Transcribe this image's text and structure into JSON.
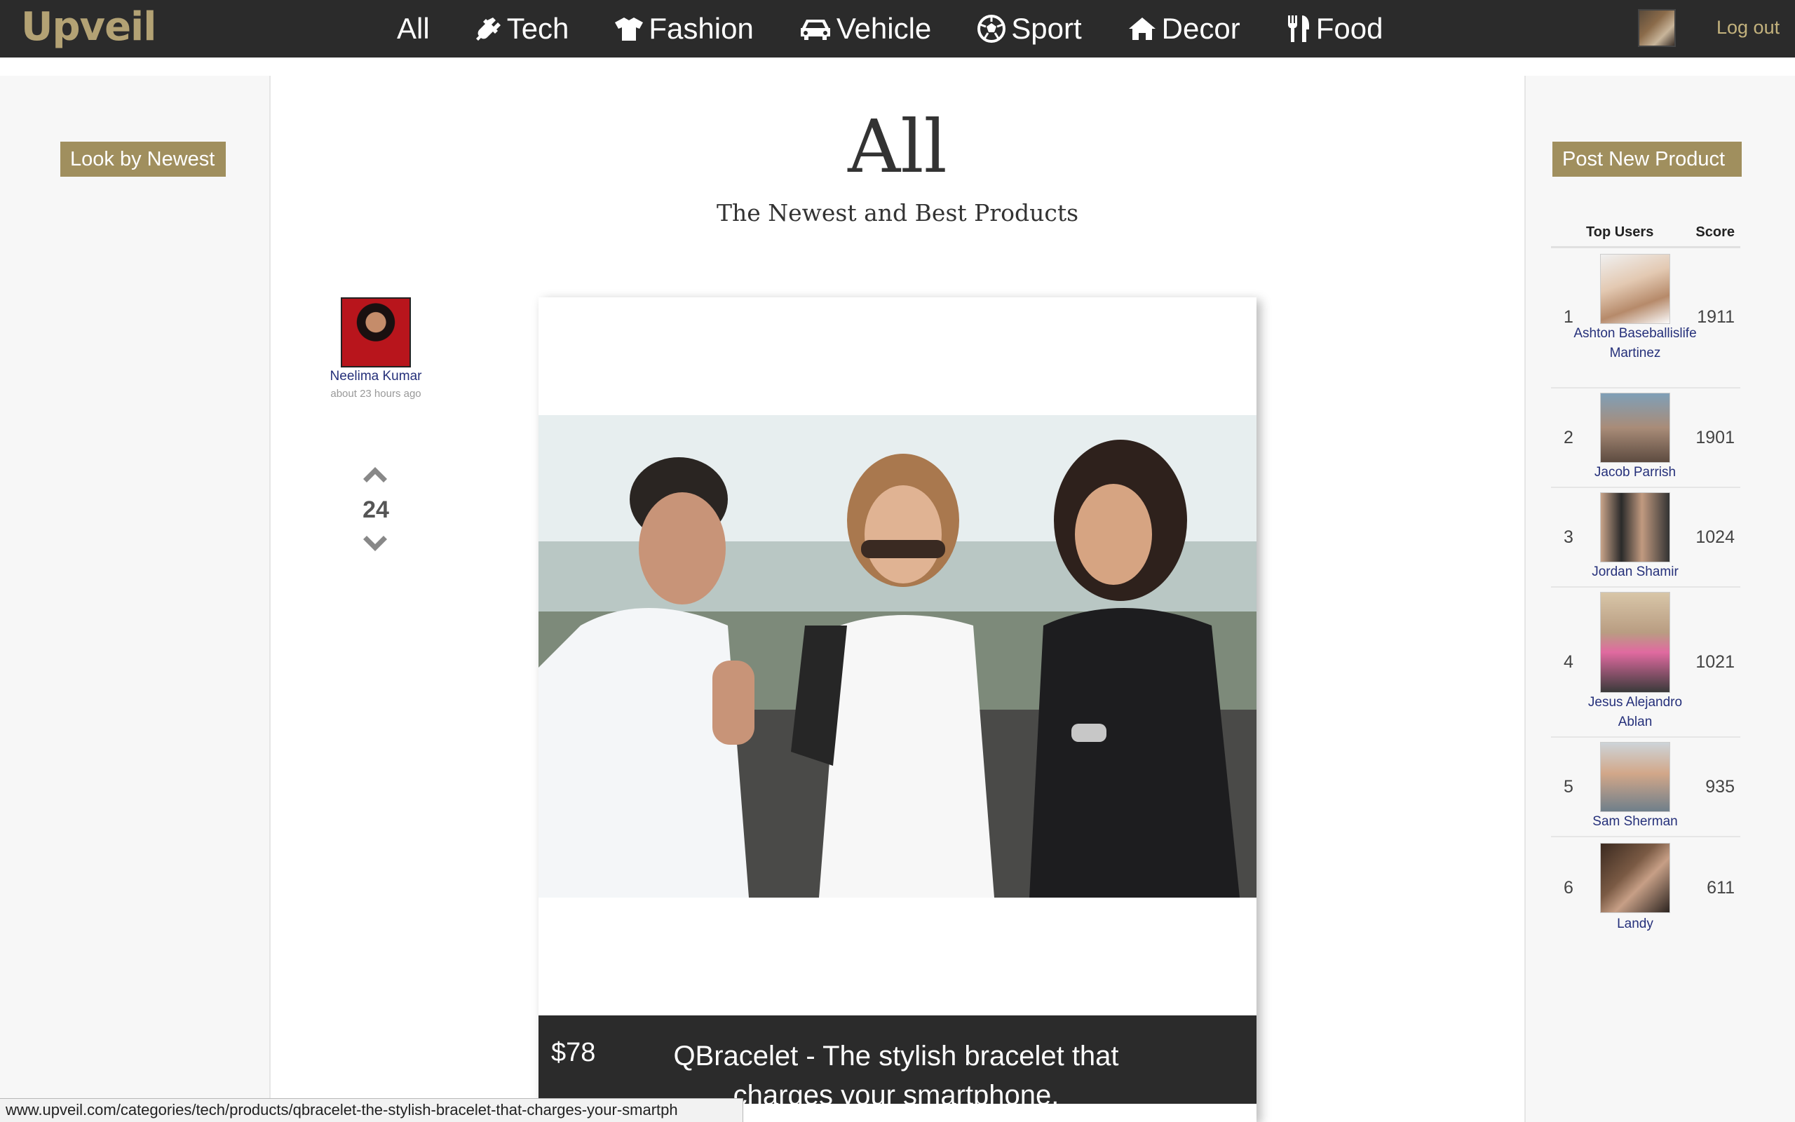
{
  "brand": "Upveil",
  "nav": {
    "items": [
      {
        "label": "All",
        "icon": ""
      },
      {
        "label": "Tech",
        "icon": "plug-icon"
      },
      {
        "label": "Fashion",
        "icon": "shirt-icon"
      },
      {
        "label": "Vehicle",
        "icon": "car-icon"
      },
      {
        "label": "Sport",
        "icon": "soccer-ball-icon"
      },
      {
        "label": "Decor",
        "icon": "home-icon"
      },
      {
        "label": "Food",
        "icon": "cutlery-icon"
      }
    ],
    "logout_label": "Log out"
  },
  "left": {
    "sort_button": "Look by Newest"
  },
  "main": {
    "title": "All",
    "subtitle": "The Newest and Best Products",
    "post": {
      "author": "Neelima Kumar",
      "time": "about 23 hours ago",
      "votes": "24",
      "price": "$78",
      "title": "QBracelet - The stylish bracelet that charges your smartphone."
    }
  },
  "right": {
    "post_button": "Post New Product",
    "leaderboard": {
      "col_users": "Top Users",
      "col_score": "Score",
      "rows": [
        {
          "rank": "1",
          "name": "Ashton Baseballislife Martinez",
          "score": "1911"
        },
        {
          "rank": "2",
          "name": "Jacob Parrish",
          "score": "1901"
        },
        {
          "rank": "3",
          "name": "Jordan Shamir",
          "score": "1024"
        },
        {
          "rank": "4",
          "name": "Jesus Alejandro Ablan",
          "score": "1021"
        },
        {
          "rank": "5",
          "name": "Sam Sherman",
          "score": "935"
        },
        {
          "rank": "6",
          "name": "Landy",
          "score": "611"
        }
      ]
    }
  },
  "status_url": "www.upveil.com/categories/tech/products/qbracelet-the-stylish-bracelet-that-charges-your-smartph",
  "colors": {
    "accent": "#a08f5e",
    "navbar": "#2b2b2b",
    "link": "#25307a"
  }
}
